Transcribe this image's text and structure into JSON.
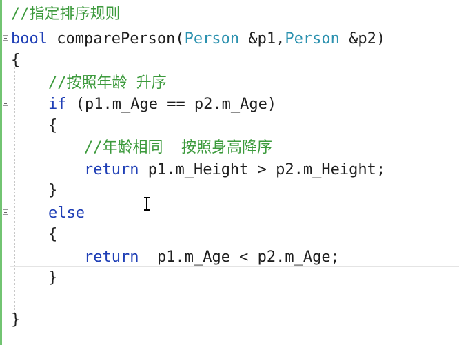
{
  "editor": {
    "language": "cpp",
    "lines": [
      {
        "tokens": [
          {
            "k": "cm",
            "t": "//指定排序规则"
          }
        ]
      },
      {
        "tokens": [
          {
            "k": "kw",
            "t": "bool"
          },
          {
            "k": "tx",
            "t": " comparePerson("
          },
          {
            "k": "ty",
            "t": "Person"
          },
          {
            "k": "tx",
            "t": " &p1,"
          },
          {
            "k": "ty",
            "t": "Person"
          },
          {
            "k": "tx",
            "t": " &p2)"
          }
        ]
      },
      {
        "tokens": [
          {
            "k": "tx",
            "t": "{"
          }
        ]
      },
      {
        "tokens": [
          {
            "k": "cm",
            "t": "//按照年龄 升序"
          }
        ]
      },
      {
        "tokens": [
          {
            "k": "kw",
            "t": "if"
          },
          {
            "k": "tx",
            "t": " (p1.m_Age == p2.m_Age)"
          }
        ]
      },
      {
        "tokens": [
          {
            "k": "tx",
            "t": "{"
          }
        ]
      },
      {
        "tokens": [
          {
            "k": "cm",
            "t": "//年龄相同  按照身高降序"
          }
        ]
      },
      {
        "tokens": [
          {
            "k": "kw",
            "t": "return"
          },
          {
            "k": "tx",
            "t": " p1.m_Height > p2.m_Height;"
          }
        ]
      },
      {
        "tokens": [
          {
            "k": "tx",
            "t": "}"
          }
        ]
      },
      {
        "tokens": [
          {
            "k": "kw",
            "t": "else"
          }
        ]
      },
      {
        "tokens": [
          {
            "k": "tx",
            "t": "{"
          }
        ]
      },
      {
        "tokens": [
          {
            "k": "kw",
            "t": "return"
          },
          {
            "k": "tx",
            "t": "  p1.m_Age < p2.m_Age;"
          }
        ]
      },
      {
        "tokens": [
          {
            "k": "tx",
            "t": "}"
          }
        ]
      },
      {
        "tokens": [
          {
            "k": "tx",
            "t": "}"
          }
        ]
      }
    ]
  },
  "colors": {
    "comment": "#3c9a3c",
    "keyword": "#1f3fb6",
    "type": "#2b91af",
    "text": "#1e1e1e",
    "change_bar": "#72c472"
  },
  "icons": [
    "collapse-minus-icon",
    "text-cursor-ibeam-icon"
  ]
}
